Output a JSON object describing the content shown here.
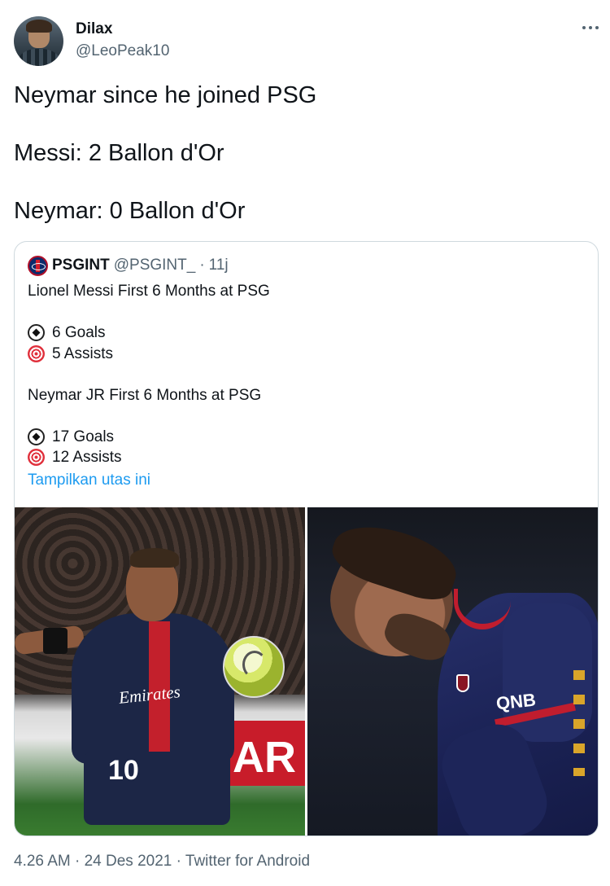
{
  "tweet": {
    "author": {
      "display_name": "Dilax",
      "handle": "@LeoPeak10",
      "avatar": "user-avatar"
    },
    "text_lines": [
      "Neymar since he joined PSG",
      "Messi: 2 Ballon d'Or",
      "Neymar: 0 Ballon d'Or"
    ],
    "meta": {
      "time": "4.26 AM",
      "separator": "·",
      "date": "24 Des 2021",
      "source": "Twitter for Android"
    }
  },
  "quoted_tweet": {
    "author": {
      "display_name": "PSGINT",
      "handle": "@PSGINT_",
      "separator": "·",
      "time": "11j"
    },
    "lines": [
      {
        "type": "text",
        "text": "Lionel Messi First 6 Months at PSG"
      },
      {
        "type": "blank"
      },
      {
        "type": "stat",
        "icon": "soccer-ball-icon",
        "text": "6 Goals"
      },
      {
        "type": "stat",
        "icon": "target-icon",
        "text": "5 Assists"
      },
      {
        "type": "blank"
      },
      {
        "type": "text",
        "text": "Neymar JR First 6 Months at PSG"
      },
      {
        "type": "blank"
      },
      {
        "type": "stat",
        "icon": "soccer-ball-icon",
        "text": "17 Goals"
      },
      {
        "type": "stat",
        "icon": "target-icon",
        "text": "12 Assists"
      }
    ],
    "show_thread": "Tampilkan utas ini",
    "images": {
      "left": {
        "name": "neymar-photo",
        "number": "10",
        "sponsor": "Emirates",
        "banner": "AR"
      },
      "right": {
        "name": "messi-photo",
        "sponsor": "QNB"
      }
    }
  },
  "colors": {
    "text": "#0f1419",
    "secondary": "#536471",
    "link": "#1d9bf0",
    "border": "#cfd9de"
  }
}
